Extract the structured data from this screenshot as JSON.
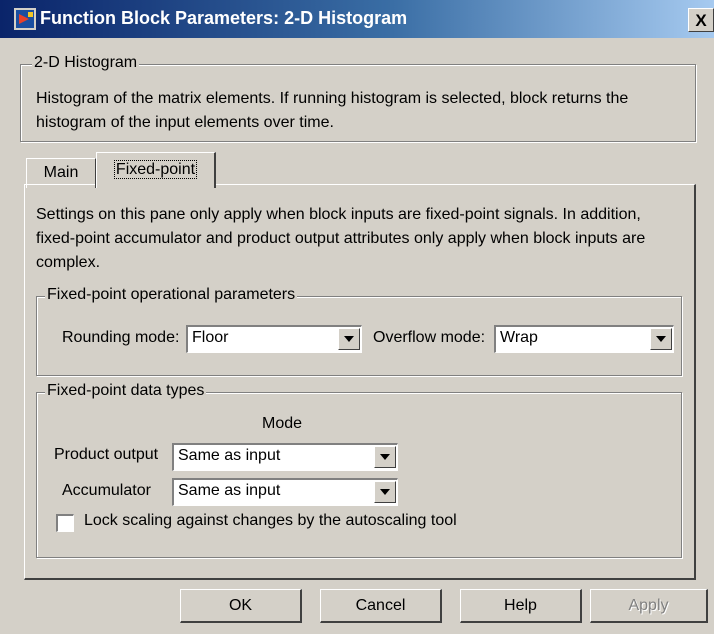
{
  "window": {
    "title": "Function Block Parameters: 2-D Histogram",
    "close_label": "X"
  },
  "block": {
    "group_title": "2-D Histogram",
    "description_line1": "Histogram of the matrix elements.  If running histogram is selected, block returns the",
    "description_line2": "histogram of the input elements over time."
  },
  "tabs": [
    {
      "label": "Main",
      "active": false
    },
    {
      "label": "Fixed-point",
      "active": true
    }
  ],
  "fixed_point": {
    "intro_line1": "Settings on this pane only apply when block inputs are fixed-point signals. In addition,",
    "intro_line2": "fixed-point accumulator and product output attributes only apply when block inputs are",
    "intro_line3": "complex.",
    "operational": {
      "title": "Fixed-point operational parameters",
      "rounding_label": "Rounding mode:",
      "rounding_value": "Floor",
      "overflow_label": "Overflow mode:",
      "overflow_value": "Wrap"
    },
    "data_types": {
      "title": "Fixed-point data types",
      "mode_header": "Mode",
      "product_label": "Product output",
      "product_value": "Same as input",
      "accumulator_label": "Accumulator",
      "accumulator_value": "Same as input",
      "lock_label": "Lock scaling against changes by the autoscaling tool",
      "lock_checked": false
    }
  },
  "buttons": {
    "ok": "OK",
    "cancel": "Cancel",
    "help": "Help",
    "apply": "Apply"
  }
}
